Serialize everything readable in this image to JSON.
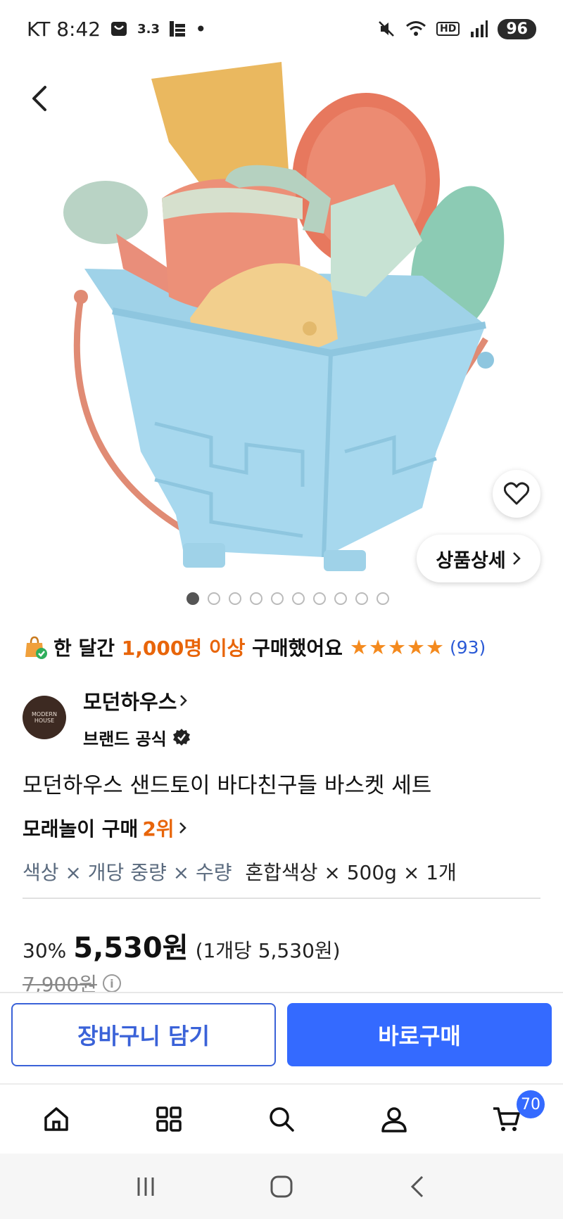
{
  "status_bar": {
    "carrier_time": "KT 8:42",
    "app_badge": "3.3",
    "dot": "•",
    "network": "HD",
    "battery": "96"
  },
  "product_image": {
    "dots_total": 10,
    "active_index": 0
  },
  "detail_button": {
    "label": "상품상세"
  },
  "purchase_stats": {
    "prefix": "한 달간",
    "highlight": "1,000명 이상",
    "suffix": "구매했어요",
    "rating_stars": 5,
    "review_count": "(93)"
  },
  "brand": {
    "logo_text": "MODERN HOUSE",
    "name": "모던하우스",
    "official_label": "브랜드 공식"
  },
  "product": {
    "title": "모던하우스 샌드토이 바다친구들 바스켓 세트",
    "rank_category": "모래놀이 구매",
    "rank": "2위",
    "option_labels": "색상 × 개당 중량 × 수량",
    "option_values": "혼합색상 × 500g × 1개"
  },
  "price": {
    "discount": "30%",
    "final": "5,530원",
    "unit_price": "(1개당 5,530원)",
    "original": "7,900원",
    "info_icon": "i"
  },
  "actions": {
    "cart_label": "장바구니 담기",
    "buy_label": "바로구매"
  },
  "bottom_nav": {
    "cart_badge": "70"
  },
  "colors": {
    "accent_blue": "#346aff",
    "highlight_orange": "#e8650a",
    "star": "#f48a1e"
  }
}
